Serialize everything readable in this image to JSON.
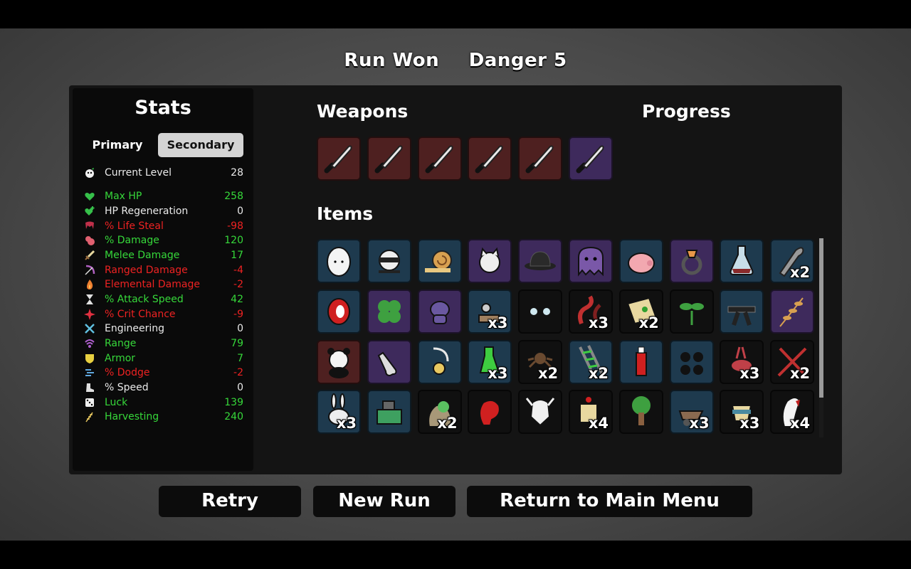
{
  "header": {
    "result": "Run Won",
    "danger": "Danger 5"
  },
  "stats": {
    "title": "Stats",
    "tabs": {
      "primary": "Primary",
      "secondary": "Secondary"
    },
    "level": {
      "label": "Current Level",
      "value": "28"
    },
    "rows": [
      {
        "label": "Max HP",
        "value": "258",
        "tone": "pos",
        "icon": "heart-icon",
        "color": "#36c04a"
      },
      {
        "label": "HP Regeneration",
        "value": "0",
        "tone": "neu",
        "icon": "heart-plus-icon",
        "color": "#36c04a"
      },
      {
        "label": "% Life Steal",
        "value": "-98",
        "tone": "neg",
        "icon": "fangs-icon",
        "color": "#c0304a"
      },
      {
        "label": "% Damage",
        "value": "120",
        "tone": "pos",
        "icon": "muscle-icon",
        "color": "#e06070"
      },
      {
        "label": "Melee Damage",
        "value": "17",
        "tone": "pos",
        "icon": "sword-icon",
        "color": "#e8d8a0"
      },
      {
        "label": "Ranged Damage",
        "value": "-4",
        "tone": "neg",
        "icon": "bow-icon",
        "color": "#b060c0"
      },
      {
        "label": "Elemental Damage",
        "value": "-2",
        "tone": "neg",
        "icon": "flame-icon",
        "color": "#f08030"
      },
      {
        "label": "% Attack Speed",
        "value": "42",
        "tone": "pos",
        "icon": "hourglass-icon",
        "color": "#e0e0e0"
      },
      {
        "label": "% Crit Chance",
        "value": "-9",
        "tone": "neg",
        "icon": "crit-icon",
        "color": "#e03040"
      },
      {
        "label": "Engineering",
        "value": "0",
        "tone": "neu",
        "icon": "wrench-icon",
        "color": "#60c0e0"
      },
      {
        "label": "Range",
        "value": "79",
        "tone": "pos",
        "icon": "range-icon",
        "color": "#b060d0"
      },
      {
        "label": "Armor",
        "value": "7",
        "tone": "pos",
        "icon": "shield-icon",
        "color": "#e8d040"
      },
      {
        "label": "% Dodge",
        "value": "-2",
        "tone": "neg",
        "icon": "dodge-icon",
        "color": "#60a8e0"
      },
      {
        "label": "% Speed",
        "value": "0",
        "tone": "neu",
        "icon": "boot-icon",
        "color": "#e0e0e0"
      },
      {
        "label": "Luck",
        "value": "139",
        "tone": "pos",
        "icon": "dice-icon",
        "color": "#f0f0f0"
      },
      {
        "label": "Harvesting",
        "value": "240",
        "tone": "pos",
        "icon": "wheat-icon",
        "color": "#e8c860"
      }
    ]
  },
  "weapons": {
    "title": "Weapons",
    "items": [
      {
        "name": "knife-icon",
        "tier": "red"
      },
      {
        "name": "knife-icon",
        "tier": "red"
      },
      {
        "name": "knife-icon",
        "tier": "red"
      },
      {
        "name": "knife-icon",
        "tier": "red"
      },
      {
        "name": "knife-icon",
        "tier": "red"
      },
      {
        "name": "knife-icon",
        "tier": "purple"
      }
    ]
  },
  "progress": {
    "title": "Progress"
  },
  "items": {
    "title": "Items",
    "list": [
      {
        "name": "egg-icon",
        "tier": "blue",
        "qty": ""
      },
      {
        "name": "ninja-icon",
        "tier": "blue",
        "qty": ""
      },
      {
        "name": "snail-icon",
        "tier": "blue",
        "qty": ""
      },
      {
        "name": "cat-icon",
        "tier": "purple",
        "qty": ""
      },
      {
        "name": "bowler-hat-icon",
        "tier": "purple",
        "qty": ""
      },
      {
        "name": "ghost-icon",
        "tier": "purple",
        "qty": ""
      },
      {
        "name": "piggy-bank-icon",
        "tier": "blue",
        "qty": ""
      },
      {
        "name": "ring-icon",
        "tier": "purple",
        "qty": ""
      },
      {
        "name": "potion-flask-icon",
        "tier": "blue",
        "qty": ""
      },
      {
        "name": "bullet-icon",
        "tier": "blue",
        "qty": "x2"
      },
      {
        "name": "red-disc-icon",
        "tier": "blue",
        "qty": ""
      },
      {
        "name": "clover-icon",
        "tier": "purple",
        "qty": ""
      },
      {
        "name": "alien-toy-icon",
        "tier": "purple",
        "qty": ""
      },
      {
        "name": "turret-icon",
        "tier": "blue",
        "qty": "x3"
      },
      {
        "name": "glowing-eyes-icon",
        "tier": "black",
        "qty": ""
      },
      {
        "name": "snake-icon",
        "tier": "black",
        "qty": "x3"
      },
      {
        "name": "treasure-map-icon",
        "tier": "black",
        "qty": "x2"
      },
      {
        "name": "sprout-icon",
        "tier": "black",
        "qty": ""
      },
      {
        "name": "black-belt-icon",
        "tier": "blue",
        "qty": ""
      },
      {
        "name": "wheat-icon",
        "tier": "purple",
        "qty": ""
      },
      {
        "name": "panda-icon",
        "tier": "red",
        "qty": ""
      },
      {
        "name": "baby-bottle-icon",
        "tier": "purple",
        "qty": ""
      },
      {
        "name": "pendant-icon",
        "tier": "blue",
        "qty": ""
      },
      {
        "name": "green-potion-icon",
        "tier": "blue",
        "qty": "x3"
      },
      {
        "name": "spider-icon",
        "tier": "black",
        "qty": "x2"
      },
      {
        "name": "ladder-icon",
        "tier": "blue",
        "qty": "x2"
      },
      {
        "name": "ketchup-icon",
        "tier": "blue",
        "qty": ""
      },
      {
        "name": "bombs-icon",
        "tier": "blue",
        "qty": ""
      },
      {
        "name": "demon-icon",
        "tier": "black",
        "qty": "x3"
      },
      {
        "name": "crossed-blades-icon",
        "tier": "black",
        "qty": "x2"
      },
      {
        "name": "rabbit-icon",
        "tier": "blue",
        "qty": "x3"
      },
      {
        "name": "machine-icon",
        "tier": "blue",
        "qty": ""
      },
      {
        "name": "sack-icon",
        "tier": "black",
        "qty": "x2"
      },
      {
        "name": "boxing-glove-icon",
        "tier": "black",
        "qty": ""
      },
      {
        "name": "skull-icon",
        "tier": "black",
        "qty": ""
      },
      {
        "name": "scroll-icon",
        "tier": "black",
        "qty": "x4"
      },
      {
        "name": "tree-icon",
        "tier": "black",
        "qty": ""
      },
      {
        "name": "wheelbarrow-icon",
        "tier": "blue",
        "qty": "x3"
      },
      {
        "name": "cup-icon",
        "tier": "black",
        "qty": "x3"
      },
      {
        "name": "fang-icon",
        "tier": "black",
        "qty": "x4"
      }
    ]
  },
  "buttons": {
    "retry": "Retry",
    "new_run": "New Run",
    "main_menu": "Return to Main Menu"
  },
  "colors": {
    "positive": "#36d83a",
    "negative": "#ee2222",
    "neutral": "#eaeaea",
    "tab_active": "#d4d4d4"
  }
}
